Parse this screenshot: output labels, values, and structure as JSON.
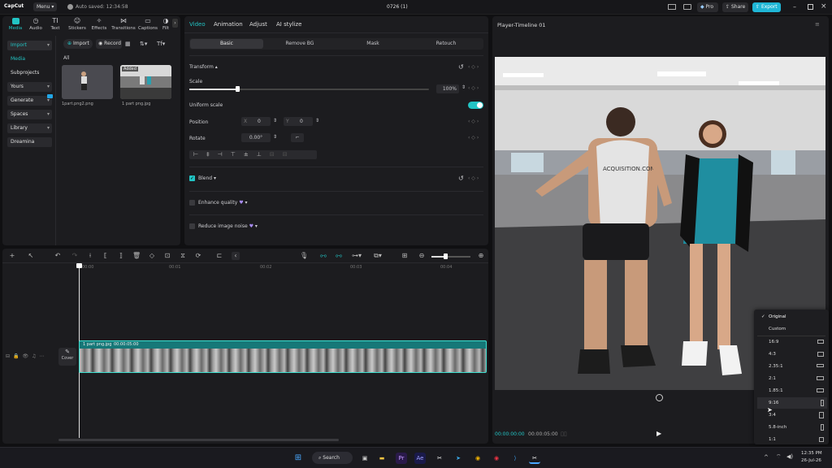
{
  "titlebar": {
    "logo": "CapCut",
    "menu": "Menu",
    "autosave": "Auto saved: 12:34:58",
    "project_title": "0726 (1)",
    "pro": "Pro",
    "share": "Share",
    "export": "Export"
  },
  "media_tabs": [
    {
      "label": "Media",
      "icon": "media-icon"
    },
    {
      "label": "Audio",
      "icon": "audio-icon"
    },
    {
      "label": "Text",
      "icon": "text-icon"
    },
    {
      "label": "Stickers",
      "icon": "stickers-icon"
    },
    {
      "label": "Effects",
      "icon": "effects-icon"
    },
    {
      "label": "Transitions",
      "icon": "transitions-icon"
    },
    {
      "label": "Captions",
      "icon": "captions-icon"
    },
    {
      "label": "Filt",
      "icon": "filters-icon"
    }
  ],
  "sidebar": {
    "import": "Import",
    "media": "Media",
    "subprojects": "Subprojects",
    "yours": "Yours",
    "generate": "Generate",
    "spaces": "Spaces",
    "library": "Library",
    "dreamina": "Dreamina"
  },
  "media_panel": {
    "import_btn": "Import",
    "record_btn": "Record",
    "all_label": "All",
    "items": [
      {
        "name": "1part.png2.png",
        "badge": ""
      },
      {
        "name": "1 part png.jpg",
        "badge": "Added"
      }
    ]
  },
  "props": {
    "tabs": [
      "Video",
      "Animation",
      "Adjust",
      "AI stylize"
    ],
    "subtabs": [
      "Basic",
      "Remove BG",
      "Mask",
      "Retouch"
    ],
    "transform": "Transform",
    "scale": "Scale",
    "scale_value": "100%",
    "uniform_scale": "Uniform scale",
    "position": "Position",
    "pos_x_label": "X",
    "pos_x": "0",
    "pos_y_label": "Y",
    "pos_y": "0",
    "rotate": "Rotate",
    "rotate_value": "0.00°",
    "blend": "Blend",
    "enhance_quality": "Enhance quality",
    "reduce_noise": "Reduce image noise"
  },
  "timeline": {
    "ticks": [
      "00:00",
      "00:01",
      "00:02",
      "00:03",
      "00:04"
    ],
    "clip_label": "1 part png.jpg",
    "clip_duration": "00:00:05:00",
    "cover": "Cover"
  },
  "player": {
    "title": "Player-Timeline 01",
    "current_time": "00:00:00:00",
    "total_time": "00:00:05:00",
    "shirt_text": "ACQUISITION.COM"
  },
  "aspect_menu": {
    "selected": "Original",
    "items": [
      "Original",
      "Custom",
      "16:9",
      "4:3",
      "2.35:1",
      "2:1",
      "1.85:1",
      "9:16",
      "3:4",
      "5.8-inch",
      "1:1"
    ]
  },
  "taskbar": {
    "search": "Search",
    "time": "12:35 PM",
    "date": "26-Jul-26"
  },
  "colors": {
    "accent": "#22c4c4",
    "panel": "#1c1c1f",
    "background": "#101012",
    "export": "#1fb6d6"
  }
}
